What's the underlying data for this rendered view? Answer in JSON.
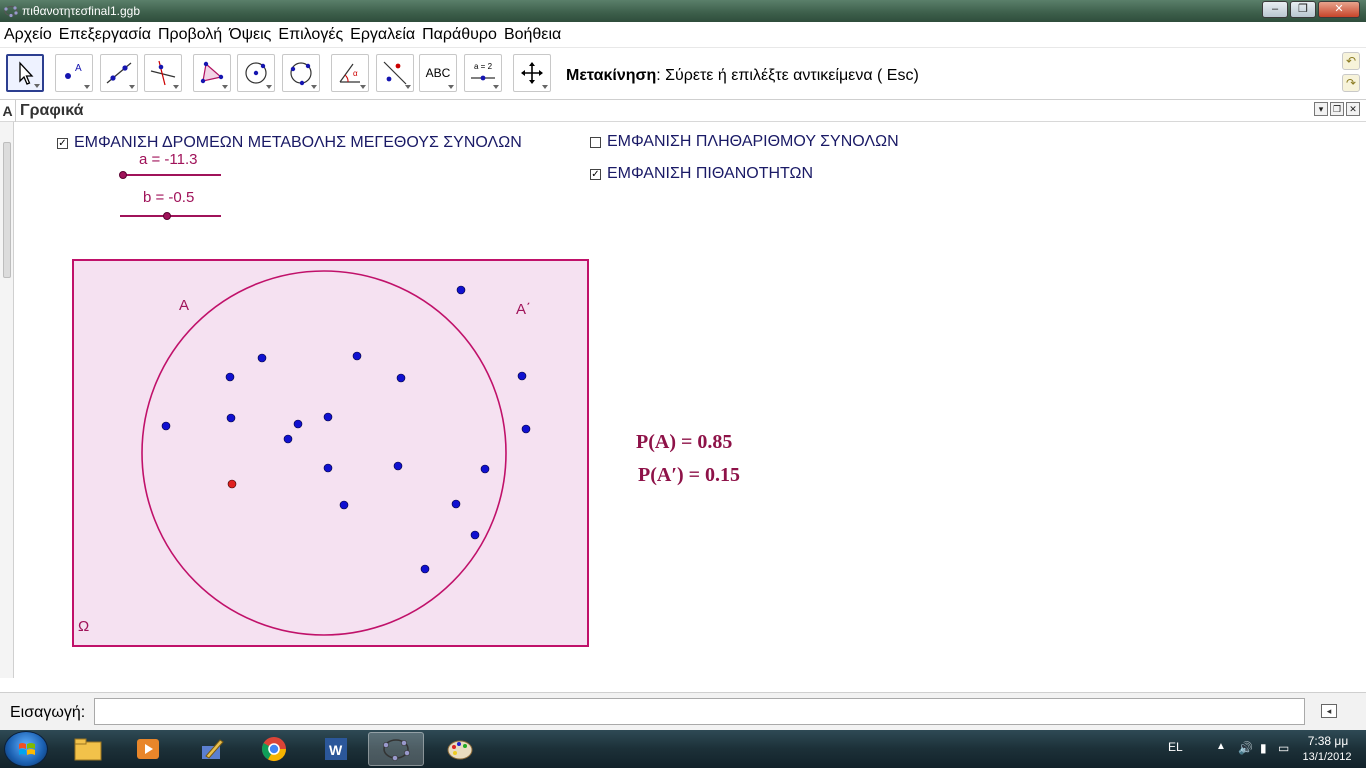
{
  "window": {
    "title": "πιθανοτητεσfinal1.ggb",
    "minimize": "–",
    "maximize": "❐",
    "close": "✕"
  },
  "menu": [
    "Αρχείο",
    "Επεξεργασία",
    "Προβολή",
    "Όψεις",
    "Επιλογές",
    "Εργαλεία",
    "Παράθυρο",
    "Βοήθεια"
  ],
  "toolbar": {
    "tools": [
      "move-tool",
      "point-tool",
      "line-tool",
      "perpendicular-line-tool",
      "polygon-tool",
      "circle-center-point-tool",
      "circle-three-points-tool",
      "angle-tool",
      "reflect-tool",
      "text-tool",
      "slider-tool",
      "move-graphics-view-tool"
    ],
    "text_tool_label": "ABC",
    "slider_tool_label": "a = 2",
    "description_bold": "Μετακίνηση",
    "description_rest": ": Σύρετε ή επιλέξτε αντικείμενα ( Esc)",
    "undo": "↶",
    "redo": "↷"
  },
  "view": {
    "side_label": "Α",
    "title": "Γραφικά"
  },
  "canvas": {
    "checkbox_sliders": {
      "label": "ΕΜΦΑΝΙΣΗ ΔΡΟΜΕΩΝ ΜΕΤΑΒΟΛΗΣ ΜΕΓΕΘΟΥΣ ΣΥΝΟΛΩΝ",
      "checked": true
    },
    "checkbox_cardinality": {
      "label": "ΕΜΦΑΝΙΣΗ ΠΛΗΘΑΡΙΘΜΟΥ ΣΥΝΟΛΩΝ",
      "checked": false
    },
    "checkbox_probabilities": {
      "label": "ΕΜΦΑΝΙΣΗ ΠΙΘΑΝΟΤΗΤΩΝ",
      "checked": true
    },
    "slider_a": {
      "label": "a = -11.3",
      "value": -11.3
    },
    "slider_b": {
      "label": "b = -0.5",
      "value": -0.5
    },
    "set_A_label": "A",
    "set_A_complement_label": "A΄",
    "omega_label": "Ω",
    "colors": {
      "set_stroke": "#c0116a",
      "set_fill": "#f5e1f1",
      "point": "#1010d0",
      "red_point": "#e02020",
      "prob_text": "#8e1248"
    },
    "points_inside_A": 14,
    "points_outside_A": 5,
    "prob_A": "P(A) = 0.85",
    "prob_A_complement": "P(A′) = 0.15"
  },
  "input": {
    "label": "Εισαγωγή:",
    "value": ""
  },
  "taskbar": {
    "apps": [
      "windows-explorer",
      "media-player",
      "paint-brush",
      "chrome",
      "word",
      "geogebra",
      "paint"
    ],
    "language": "EL",
    "time": "7:38 μμ",
    "date": "13/1/2012"
  }
}
